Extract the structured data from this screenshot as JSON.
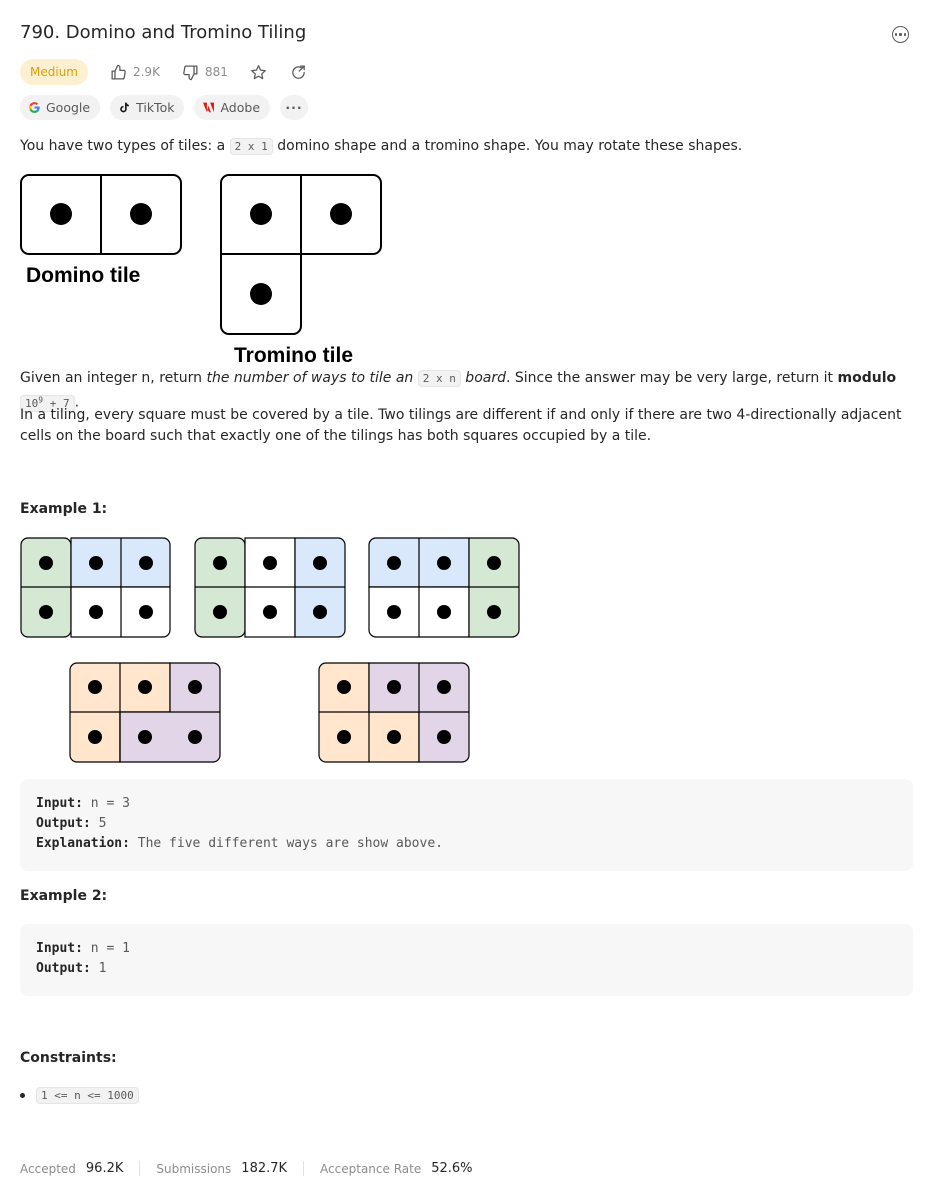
{
  "problem": {
    "title": "790. Domino and Tromino Tiling",
    "difficulty": "Medium",
    "likes": "2.9K",
    "dislikes": "881"
  },
  "companies": [
    {
      "name": "Google"
    },
    {
      "name": "TikTok"
    },
    {
      "name": "Adobe"
    }
  ],
  "companies_more": "···",
  "description": {
    "p1_before": "You have two types of tiles: a ",
    "p1_code": "2 x 1",
    "p1_after": " domino shape and a tromino shape. You may rotate these shapes.",
    "p2_a": "Given an integer n, return ",
    "p2_em1": "the number of ways to tile an ",
    "p2_code": "2 x n",
    "p2_em2": " board",
    "p2_b": ". Since the answer may be very large, return it ",
    "p2_bold": "modulo",
    "p2_mod_base": "10",
    "p2_mod_exp": "9",
    "p2_mod_rest": " + 7",
    "p2_end": ".",
    "p3": "In a tiling, every square must be covered by a tile. Two tilings are different if and only if there are two 4-directionally adjacent cells on the board such that exactly one of the tilings has both squares occupied by a tile."
  },
  "tiles_figure": {
    "domino_label": "Domino tile",
    "tromino_label": "Tromino tile"
  },
  "example1": {
    "heading": "Example 1:",
    "input_label": "Input:",
    "input_value": "n = 3",
    "output_label": "Output:",
    "output_value": "5",
    "explanation_label": "Explanation:",
    "explanation_value": "The five different ways are show above."
  },
  "example2": {
    "heading": "Example 2:",
    "input_label": "Input:",
    "input_value": "n = 1",
    "output_label": "Output:",
    "output_value": "1"
  },
  "constraints": {
    "heading": "Constraints:",
    "items": [
      "1 <= n <= 1000"
    ]
  },
  "stats": {
    "accepted_label": "Accepted",
    "accepted_value": "96.2K",
    "submissions_label": "Submissions",
    "submissions_value": "182.7K",
    "rate_label": "Acceptance Rate",
    "rate_value": "52.6%"
  },
  "colors": {
    "green": "#d5e8d4",
    "blue": "#dae8fc",
    "orange": "#ffe6cc",
    "purple": "#e1d5e7",
    "white": "#ffffff"
  }
}
